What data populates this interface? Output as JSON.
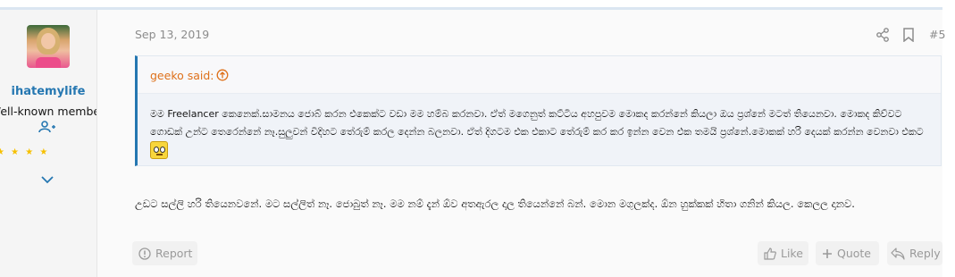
{
  "post": {
    "date": "Sep 13, 2019",
    "number": "#5",
    "author": {
      "username": "ihatemylife",
      "title": "Well-known member",
      "stars": "★ ★ ★ ★"
    },
    "quote": {
      "author_label": "geeko said:",
      "text": "මම Freelancer කෙනෙක්.සාමනය ජොබ් කරන එකෙක්ට වඩා මම හම්බ කරනවා. ඒත් මගෙනුත් කට්ටිය අහපුවම මොකද කරන්නේ කියලා ඔය ප්‍රශ්නේ මටත් තියෙනවා. මොකද කිව්වට ගොඩක් උන්ට තෙරෙන්නේ නෑ.සුලුවන් විදිහට තේරුම් කරල දෙන්න බලනවා. ඒත් දිගටම එක එකාට තේරුම් කර කර ඉන්න වෙන එක තමයි ප්‍රශ්නේ.මොකක් හරි දෙයක් කරන්න වෙනවා එකට"
    },
    "body": "උඩට සල්ලි හරි තියෙනවනේ. මට සල්ලිත් නෑ. ජොබුත් නෑ. මම නම් දැන් ඕව අතඇරල දාල තියෙන්නේ බන්. මොන මගුලක්ද. ඕන හුක්කක් හිතා ගනින් කියල. කෙලල දානව.",
    "actions": {
      "report": "Report",
      "like": "Like",
      "quote": "Quote",
      "reply": "Reply"
    }
  },
  "colors": {
    "accent": "#2577b1",
    "quote_author": "#de7019",
    "muted": "#8c8c8c",
    "stars": "#f6c000"
  },
  "icons": [
    "staff-icon",
    "chevron-down-icon",
    "share-icon",
    "bookmark-icon",
    "arrow-up-circle-icon",
    "report-icon",
    "like-icon",
    "plus-icon",
    "reply-icon",
    "emoji-icon"
  ]
}
